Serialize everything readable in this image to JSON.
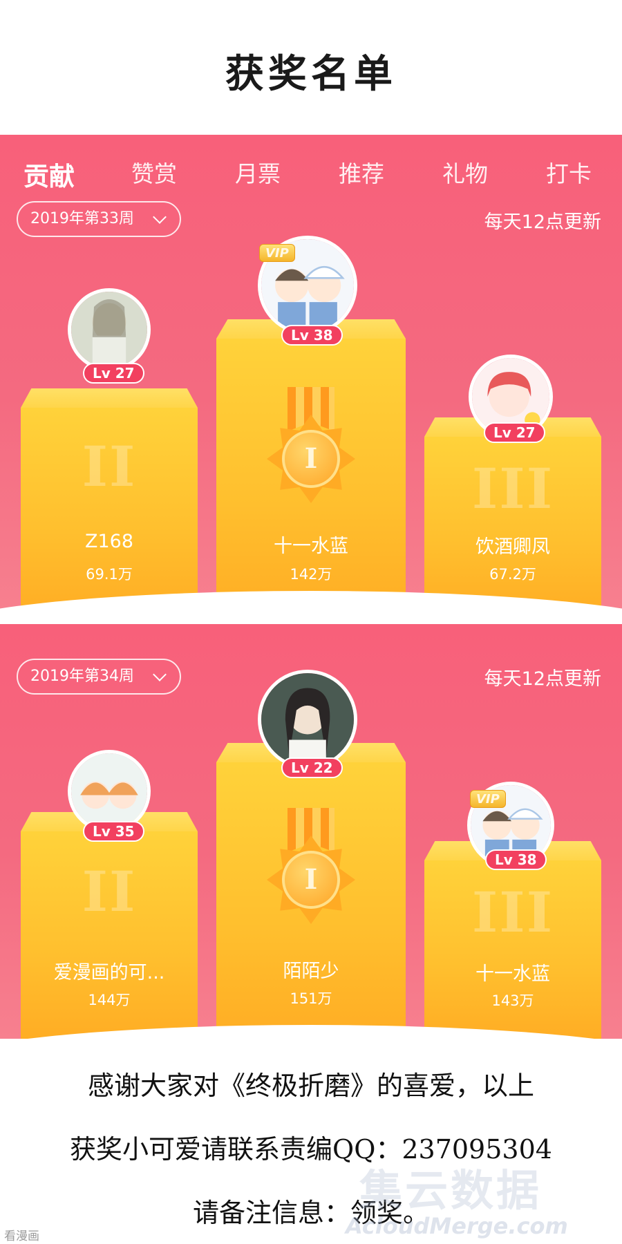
{
  "page_title": "获奖名单",
  "tabs": [
    {
      "label": "贡献",
      "active": true
    },
    {
      "label": "赞赏",
      "active": false
    },
    {
      "label": "月票",
      "active": false
    },
    {
      "label": "推荐",
      "active": false
    },
    {
      "label": "礼物",
      "active": false
    },
    {
      "label": "打卡",
      "active": false
    }
  ],
  "panels": [
    {
      "week": "2019年第33周",
      "update_note": "每天12点更新",
      "podium": [
        {
          "rank": "II",
          "name": "Z168",
          "score": "69.1万",
          "level": "Lv 27",
          "vip": false
        },
        {
          "rank": "I",
          "name": "十一水蓝",
          "score": "142万",
          "level": "Lv 38",
          "vip": true
        },
        {
          "rank": "III",
          "name": "饮酒卿凤",
          "score": "67.2万",
          "level": "Lv 27",
          "vip": false
        }
      ]
    },
    {
      "week": "2019年第34周",
      "update_note": "每天12点更新",
      "podium": [
        {
          "rank": "II",
          "name": "爱漫画的可...",
          "score": "144万",
          "level": "Lv 35",
          "vip": false
        },
        {
          "rank": "I",
          "name": "陌陌少",
          "score": "151万",
          "level": "Lv 22",
          "vip": false
        },
        {
          "rank": "III",
          "name": "十一水蓝",
          "score": "143万",
          "level": "Lv 38",
          "vip": true
        }
      ]
    }
  ],
  "vip_label": "VIP",
  "footer": {
    "line1": "感谢大家对《终极折磨》的喜爱，以上",
    "line2": "获奖小可爱请联系责编QQ：237095304",
    "line3": "请备注信息：领奖。"
  },
  "watermark": {
    "main": "集云数据",
    "sub": "AcloudMerge.com"
  },
  "source_tag": "看漫画",
  "colors": {
    "panel": "#f8607a",
    "podium": "#ffc12e",
    "level_badge": "#f2405f"
  }
}
